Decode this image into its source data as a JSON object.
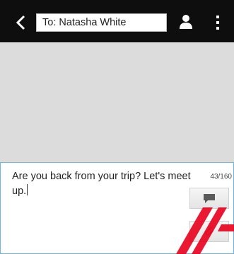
{
  "header": {
    "recipient": "To: Natasha White"
  },
  "compose": {
    "message": "Are you back from your trip? Let's meet up.",
    "char_count": "43/160"
  },
  "icons": {
    "back": "chevron-left-icon",
    "contact": "person-icon",
    "menu": "more-vertical-icon",
    "send": "speech-bubble-icon",
    "attach": "paperclip-icon"
  },
  "colors": {
    "topbar": "#0e0e0e",
    "thread_background": "#dcdcdc",
    "compose_border": "#6fb3e0",
    "watermark": "#e8001c"
  }
}
